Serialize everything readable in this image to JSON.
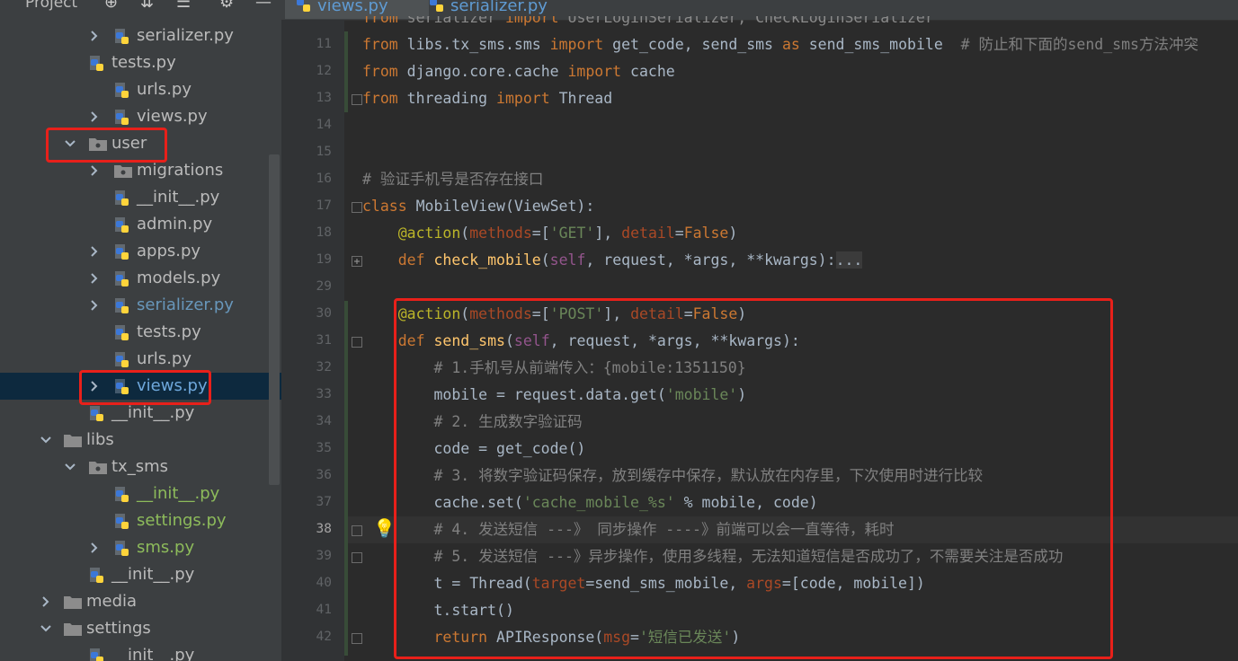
{
  "project_panel": {
    "title": "Project",
    "tree": [
      {
        "label": "serializer.py",
        "kind": "py",
        "arrow": "right",
        "color": "default"
      },
      {
        "label": "tests.py",
        "kind": "py",
        "arrow": "none",
        "color": "default"
      },
      {
        "label": "urls.py",
        "kind": "py",
        "arrow": "none",
        "color": "default"
      },
      {
        "label": "views.py",
        "kind": "py",
        "arrow": "right",
        "color": "default"
      },
      {
        "label": "user",
        "kind": "package",
        "arrow": "down",
        "color": "default"
      },
      {
        "label": "migrations",
        "kind": "package",
        "arrow": "right",
        "color": "default"
      },
      {
        "label": "__init__.py",
        "kind": "py",
        "arrow": "none",
        "color": "default"
      },
      {
        "label": "admin.py",
        "kind": "py",
        "arrow": "none",
        "color": "default"
      },
      {
        "label": "apps.py",
        "kind": "py",
        "arrow": "right",
        "color": "default"
      },
      {
        "label": "models.py",
        "kind": "py",
        "arrow": "right",
        "color": "default"
      },
      {
        "label": "serializer.py",
        "kind": "py",
        "arrow": "right",
        "color": "blue"
      },
      {
        "label": "tests.py",
        "kind": "py",
        "arrow": "none",
        "color": "default"
      },
      {
        "label": "urls.py",
        "kind": "py",
        "arrow": "none",
        "color": "default"
      },
      {
        "label": "views.py",
        "kind": "py",
        "arrow": "right",
        "color": "selected"
      },
      {
        "label": "__init__.py",
        "kind": "py",
        "arrow": "none",
        "color": "default"
      },
      {
        "label": "libs",
        "kind": "folder",
        "arrow": "down",
        "color": "default"
      },
      {
        "label": "tx_sms",
        "kind": "package",
        "arrow": "down",
        "color": "default"
      },
      {
        "label": "__init__.py",
        "kind": "py",
        "arrow": "none",
        "color": "green"
      },
      {
        "label": "settings.py",
        "kind": "py",
        "arrow": "none",
        "color": "green"
      },
      {
        "label": "sms.py",
        "kind": "py",
        "arrow": "right",
        "color": "green"
      },
      {
        "label": "__init__.py",
        "kind": "py",
        "arrow": "none",
        "color": "default"
      },
      {
        "label": "media",
        "kind": "folder",
        "arrow": "right",
        "color": "default"
      },
      {
        "label": "settings",
        "kind": "folder",
        "arrow": "down",
        "color": "default"
      },
      {
        "label": "__init__.py",
        "kind": "py",
        "arrow": "none",
        "color": "default"
      }
    ]
  },
  "tabs": [
    {
      "label": "views.py",
      "active": true
    },
    {
      "label": "serializer.py",
      "active": false
    }
  ],
  "editor": {
    "current_line": "38",
    "lines": [
      {
        "n": "11",
        "code": "from libs.tx_sms.sms import get_code, send_sms as send_sms_mobile  # 防止和下面的send_sms方法冲突"
      },
      {
        "n": "12",
        "code": "from django.core.cache import cache"
      },
      {
        "n": "13",
        "code": "from threading import Thread"
      },
      {
        "n": "14",
        "code": ""
      },
      {
        "n": "15",
        "code": ""
      },
      {
        "n": "16",
        "code": "# 验证手机号是否存在接口"
      },
      {
        "n": "17",
        "code": "class MobileView(ViewSet):"
      },
      {
        "n": "18",
        "code": "    @action(methods=['GET'], detail=False)"
      },
      {
        "n": "19",
        "code": "    def check_mobile(self, request, *args, **kwargs):..."
      },
      {
        "n": "29",
        "code": ""
      },
      {
        "n": "30",
        "code": "    @action(methods=['POST'], detail=False)"
      },
      {
        "n": "31",
        "code": "    def send_sms(self, request, *args, **kwargs):"
      },
      {
        "n": "32",
        "code": "        # 1.手机号从前端传入：{mobile:1351150}"
      },
      {
        "n": "33",
        "code": "        mobile = request.data.get('mobile')"
      },
      {
        "n": "34",
        "code": "        # 2. 生成数字验证码"
      },
      {
        "n": "35",
        "code": "        code = get_code()"
      },
      {
        "n": "36",
        "code": "        # 3. 将数字验证码保存，放到缓存中保存，默认放在内存里，下次使用时进行比较"
      },
      {
        "n": "37",
        "code": "        cache.set('cache_mobile_%s' % mobile, code)"
      },
      {
        "n": "38",
        "code": "        # 4. 发送短信 ---》 同步操作 ----》前端可以会一直等待，耗时"
      },
      {
        "n": "39",
        "code": "        # 5. 发送短信 ---》异步操作，使用多线程，无法知道短信是否成功了，不需要关注是否成功"
      },
      {
        "n": "40",
        "code": "        t = Thread(target=send_sms_mobile, args=[code, mobile])"
      },
      {
        "n": "41",
        "code": "        t.start()"
      },
      {
        "n": "42",
        "code": "        return APIResponse(msg='短信已发送')"
      }
    ]
  },
  "colors": {
    "panel_bg": "#3c3f41",
    "editor_bg": "#2b2b2b",
    "annotation_red": "#e8201a",
    "keyword": "#cc7832",
    "string": "#6a8759",
    "comment": "#808080",
    "decorator": "#bbb529"
  },
  "icons": [
    "crosshair-icon",
    "collapse-all-icon",
    "expand-all-icon",
    "gear-icon",
    "minimize-icon",
    "bulb-icon",
    "python-file-icon",
    "folder-icon",
    "package-icon"
  ]
}
